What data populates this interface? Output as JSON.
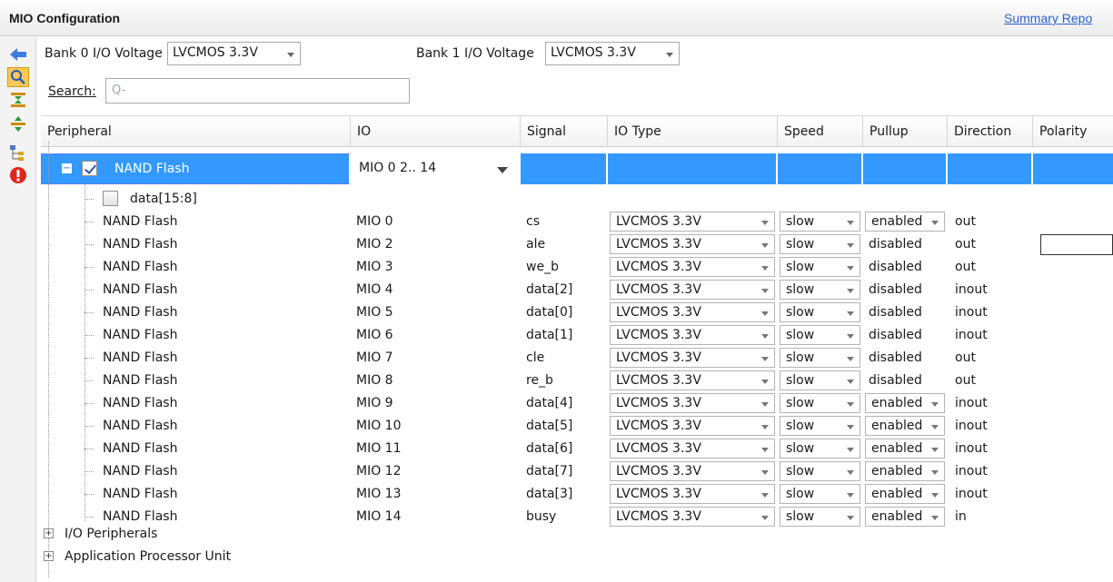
{
  "panel": {
    "title": "MIO Configuration",
    "summary_link": "Summary Repo"
  },
  "toolstrip": {
    "icons": [
      "back-arrow-icon",
      "search-icon",
      "collapse-all-icon",
      "expand-all-icon",
      "tree-filter-icon",
      "error-icon"
    ]
  },
  "bank0": {
    "label": "Bank 0 I/O Voltage",
    "value": "LVCMOS 3.3V"
  },
  "bank1": {
    "label": "Bank 1 I/O Voltage",
    "value": "LVCMOS 3.3V"
  },
  "search": {
    "label": "Search:",
    "value": "",
    "icon": "Q-"
  },
  "columns": [
    "Peripheral",
    "IO",
    "Signal",
    "IO Type",
    "Speed",
    "Pullup",
    "Direction",
    "Polarity"
  ],
  "selected_row": {
    "peripheral": "NAND Flash",
    "io": "MIO 0 2.. 14",
    "checked": true,
    "expanded": true
  },
  "data_row": {
    "label": "data[15:8]",
    "checked": false
  },
  "rows": [
    {
      "peripheral": "NAND Flash",
      "io": "MIO 0",
      "signal": "cs",
      "io_type": "LVCMOS 3.3V",
      "speed": "slow",
      "pullup": "enabled",
      "pullup_dropdown": true,
      "direction": "out"
    },
    {
      "peripheral": "NAND Flash",
      "io": "MIO 2",
      "signal": "ale",
      "io_type": "LVCMOS 3.3V",
      "speed": "slow",
      "pullup": "disabled",
      "pullup_dropdown": false,
      "direction": "out"
    },
    {
      "peripheral": "NAND Flash",
      "io": "MIO 3",
      "signal": "we_b",
      "io_type": "LVCMOS 3.3V",
      "speed": "slow",
      "pullup": "disabled",
      "pullup_dropdown": false,
      "direction": "out"
    },
    {
      "peripheral": "NAND Flash",
      "io": "MIO 4",
      "signal": "data[2]",
      "io_type": "LVCMOS 3.3V",
      "speed": "slow",
      "pullup": "disabled",
      "pullup_dropdown": false,
      "direction": "inout"
    },
    {
      "peripheral": "NAND Flash",
      "io": "MIO 5",
      "signal": "data[0]",
      "io_type": "LVCMOS 3.3V",
      "speed": "slow",
      "pullup": "disabled",
      "pullup_dropdown": false,
      "direction": "inout"
    },
    {
      "peripheral": "NAND Flash",
      "io": "MIO 6",
      "signal": "data[1]",
      "io_type": "LVCMOS 3.3V",
      "speed": "slow",
      "pullup": "disabled",
      "pullup_dropdown": false,
      "direction": "inout"
    },
    {
      "peripheral": "NAND Flash",
      "io": "MIO 7",
      "signal": "cle",
      "io_type": "LVCMOS 3.3V",
      "speed": "slow",
      "pullup": "disabled",
      "pullup_dropdown": false,
      "direction": "out"
    },
    {
      "peripheral": "NAND Flash",
      "io": "MIO 8",
      "signal": "re_b",
      "io_type": "LVCMOS 3.3V",
      "speed": "slow",
      "pullup": "disabled",
      "pullup_dropdown": false,
      "direction": "out"
    },
    {
      "peripheral": "NAND Flash",
      "io": "MIO 9",
      "signal": "data[4]",
      "io_type": "LVCMOS 3.3V",
      "speed": "slow",
      "pullup": "enabled",
      "pullup_dropdown": true,
      "direction": "inout"
    },
    {
      "peripheral": "NAND Flash",
      "io": "MIO 10",
      "signal": "data[5]",
      "io_type": "LVCMOS 3.3V",
      "speed": "slow",
      "pullup": "enabled",
      "pullup_dropdown": true,
      "direction": "inout"
    },
    {
      "peripheral": "NAND Flash",
      "io": "MIO 11",
      "signal": "data[6]",
      "io_type": "LVCMOS 3.3V",
      "speed": "slow",
      "pullup": "enabled",
      "pullup_dropdown": true,
      "direction": "inout"
    },
    {
      "peripheral": "NAND Flash",
      "io": "MIO 12",
      "signal": "data[7]",
      "io_type": "LVCMOS 3.3V",
      "speed": "slow",
      "pullup": "enabled",
      "pullup_dropdown": true,
      "direction": "inout"
    },
    {
      "peripheral": "NAND Flash",
      "io": "MIO 13",
      "signal": "data[3]",
      "io_type": "LVCMOS 3.3V",
      "speed": "slow",
      "pullup": "enabled",
      "pullup_dropdown": true,
      "direction": "inout"
    },
    {
      "peripheral": "NAND Flash",
      "io": "MIO 14",
      "signal": "busy",
      "io_type": "LVCMOS 3.3V",
      "speed": "slow",
      "pullup": "enabled",
      "pullup_dropdown": true,
      "direction": "in"
    }
  ],
  "groups": [
    {
      "label": "I/O Peripherals"
    },
    {
      "label": "Application Processor Unit"
    }
  ],
  "colors": {
    "selection": "#3399ff",
    "link": "#2a62c9"
  }
}
